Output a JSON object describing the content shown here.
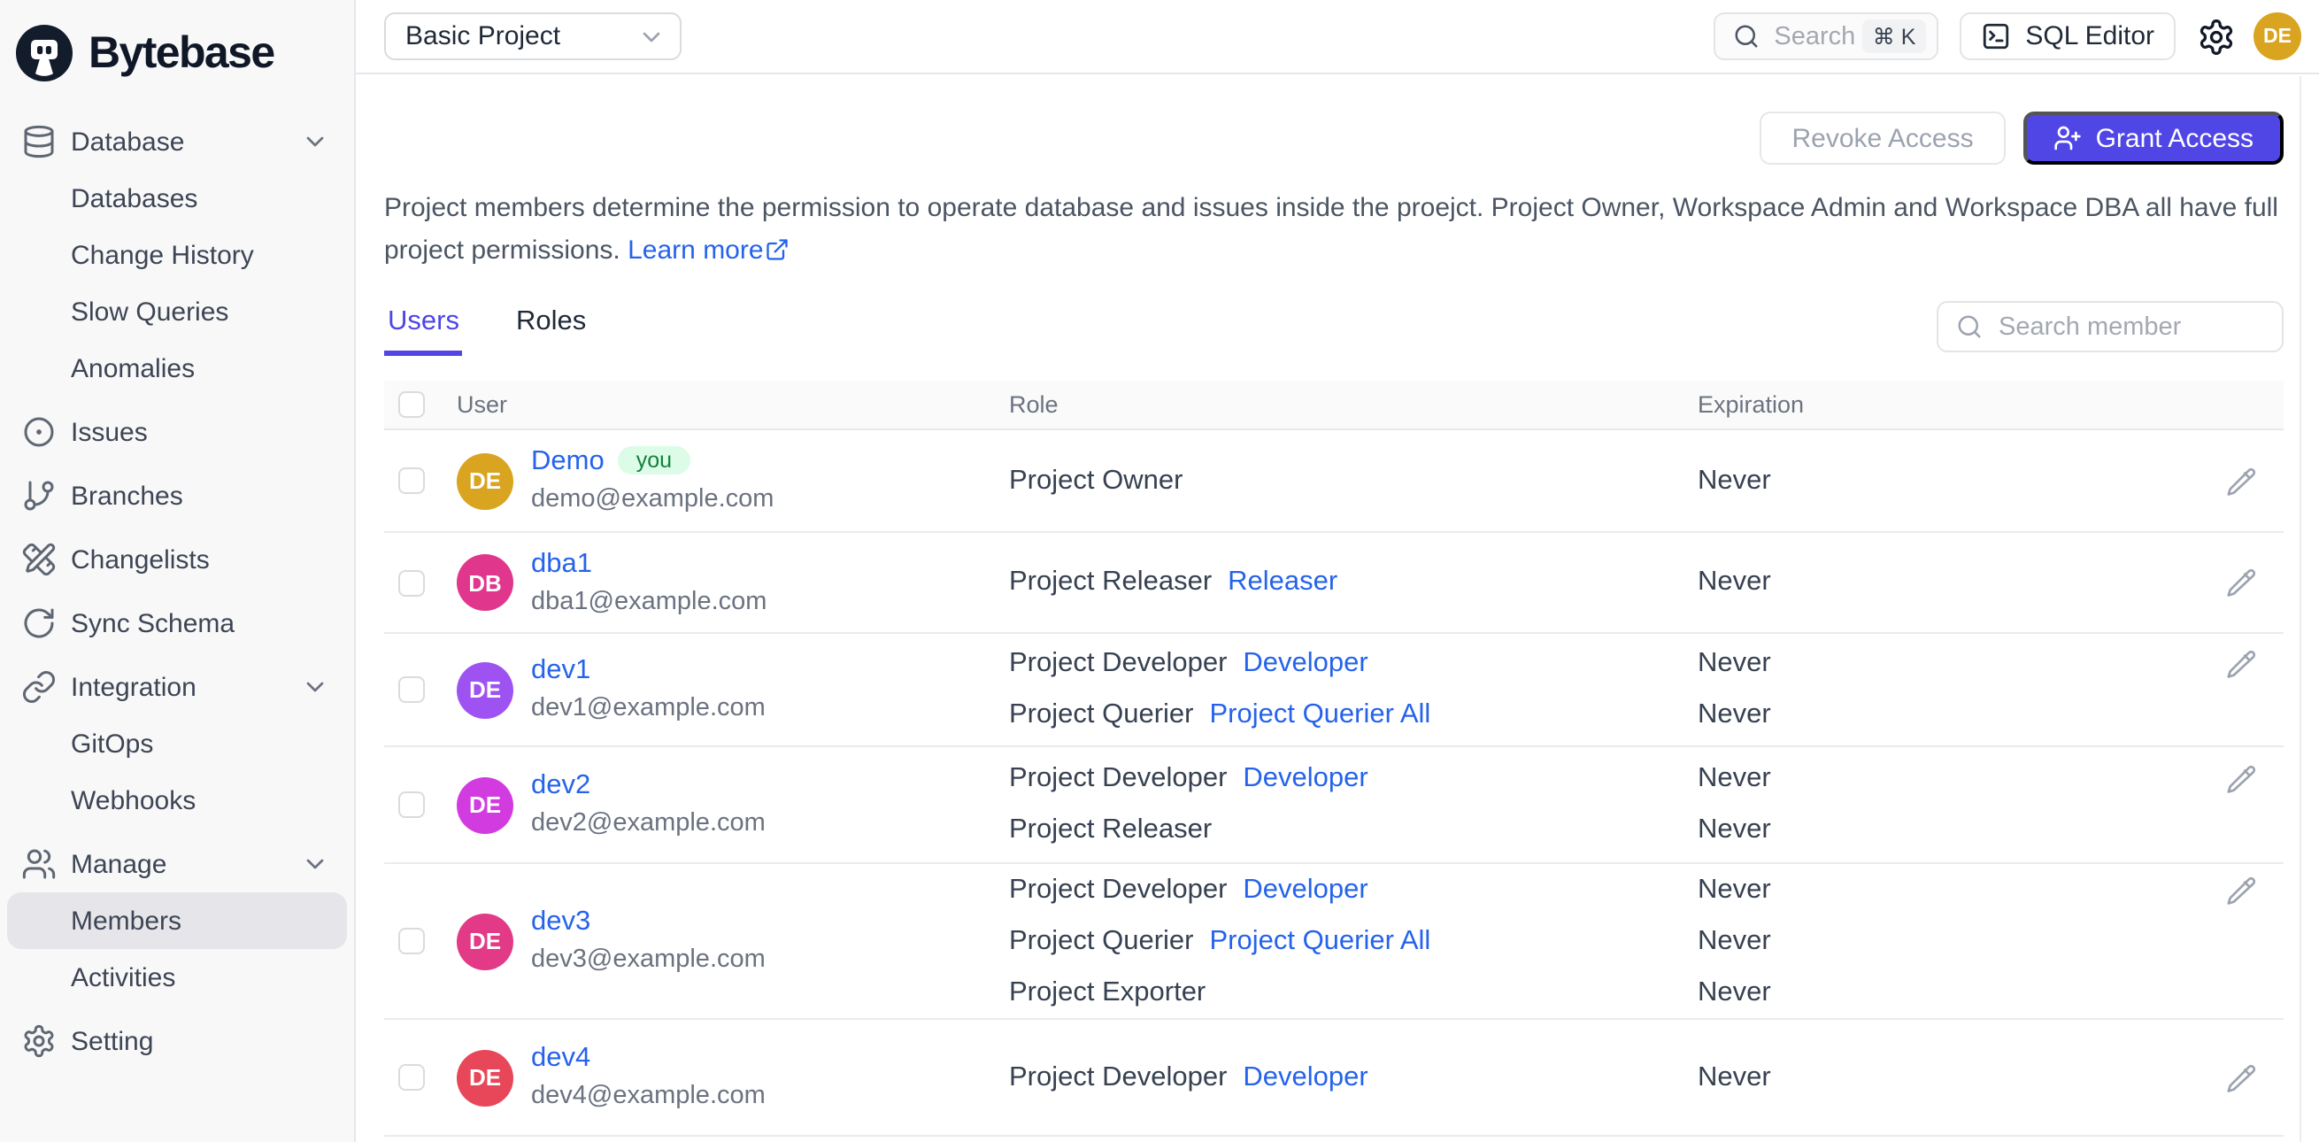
{
  "brand": {
    "name": "Bytebase"
  },
  "topbar": {
    "project_selector": "Basic Project",
    "search_label": "Search",
    "search_shortcut": "⌘ K",
    "sql_editor_label": "SQL Editor",
    "avatar_initials": "DE",
    "avatar_color": "#d9a41f"
  },
  "sidebar": {
    "items": [
      {
        "label": "Database",
        "icon": "database",
        "type": "top",
        "chevron": true
      },
      {
        "label": "Databases",
        "type": "sub"
      },
      {
        "label": "Change History",
        "type": "sub"
      },
      {
        "label": "Slow Queries",
        "type": "sub"
      },
      {
        "label": "Anomalies",
        "type": "sub"
      },
      {
        "label": "Issues",
        "icon": "circle-dot",
        "type": "top"
      },
      {
        "label": "Branches",
        "icon": "git-branch",
        "type": "top"
      },
      {
        "label": "Changelists",
        "icon": "pencil-ruler",
        "type": "top"
      },
      {
        "label": "Sync Schema",
        "icon": "refresh",
        "type": "top"
      },
      {
        "label": "Integration",
        "icon": "link",
        "type": "top",
        "chevron": true
      },
      {
        "label": "GitOps",
        "type": "sub"
      },
      {
        "label": "Webhooks",
        "type": "sub"
      },
      {
        "label": "Manage",
        "icon": "users",
        "type": "top",
        "chevron": true
      },
      {
        "label": "Members",
        "type": "sub",
        "active": true
      },
      {
        "label": "Activities",
        "type": "sub"
      },
      {
        "label": "Setting",
        "icon": "gear",
        "type": "top"
      }
    ]
  },
  "page": {
    "revoke_button": "Revoke Access",
    "grant_button": "Grant Access",
    "description_line1": "Project members determine the permission to operate database and issues inside the proejct. Project Owner, Workspace Admin and Workspace DBA all have full",
    "description_line2": "project permissions.",
    "learn_more": "Learn more",
    "tabs": [
      {
        "label": "Users",
        "active": true
      },
      {
        "label": "Roles",
        "active": false
      }
    ],
    "search_placeholder": "Search member",
    "accent_color": "#4f46e5",
    "link_color": "#2563eb",
    "table": {
      "columns": [
        "User",
        "Role",
        "Expiration"
      ],
      "rows": [
        {
          "initials": "DE",
          "avatar_color": "#d9a41f",
          "name": "Demo",
          "badge": "you",
          "email": "demo@example.com",
          "roles": [
            {
              "text": "Project Owner",
              "link": ""
            }
          ],
          "expirations": [
            "Never"
          ]
        },
        {
          "initials": "DB",
          "avatar_color": "#e0368c",
          "name": "dba1",
          "badge": "",
          "email": "dba1@example.com",
          "roles": [
            {
              "text": "Project Releaser",
              "link": "Releaser"
            }
          ],
          "expirations": [
            "Never"
          ]
        },
        {
          "initials": "DE",
          "avatar_color": "#9f52f2",
          "name": "dev1",
          "badge": "",
          "email": "dev1@example.com",
          "roles": [
            {
              "text": "Project Developer",
              "link": "Developer"
            },
            {
              "text": "Project Querier",
              "link": "Project Querier All"
            }
          ],
          "expirations": [
            "Never",
            "Never"
          ]
        },
        {
          "initials": "DE",
          "avatar_color": "#d23be0",
          "name": "dev2",
          "badge": "",
          "email": "dev2@example.com",
          "roles": [
            {
              "text": "Project Developer",
              "link": "Developer"
            },
            {
              "text": "Project Releaser",
              "link": ""
            }
          ],
          "expirations": [
            "Never",
            "Never"
          ]
        },
        {
          "initials": "DE",
          "avatar_color": "#e23a87",
          "name": "dev3",
          "badge": "",
          "email": "dev3@example.com",
          "roles": [
            {
              "text": "Project Developer",
              "link": "Developer"
            },
            {
              "text": "Project Querier",
              "link": "Project Querier All"
            },
            {
              "text": "Project Exporter",
              "link": ""
            }
          ],
          "expirations": [
            "Never",
            "Never",
            "Never"
          ]
        },
        {
          "initials": "DE",
          "avatar_color": "#e8475a",
          "name": "dev4",
          "badge": "",
          "email": "dev4@example.com",
          "roles": [
            {
              "text": "Project Developer",
              "link": "Developer"
            }
          ],
          "expirations": [
            "Never"
          ]
        }
      ]
    }
  }
}
